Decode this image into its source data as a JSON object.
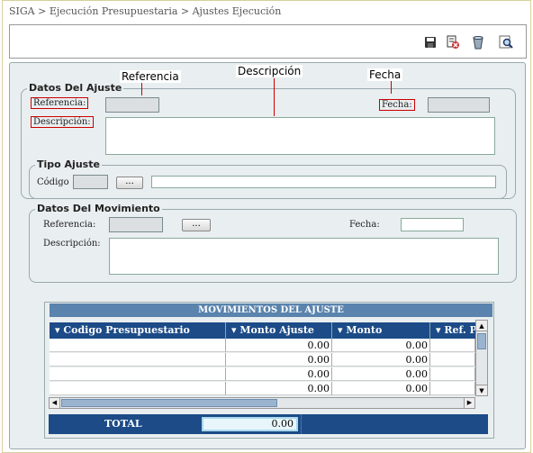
{
  "breadcrumb": "SIGA > Ejecución Presupuestaria > Ajustes Ejecución",
  "toolbar": {
    "icons": [
      "save-icon",
      "delete-icon",
      "clear-icon",
      "search-icon"
    ]
  },
  "annotations": {
    "referencia": "Referencia",
    "descripcion": "Descripción",
    "fecha": "Fecha"
  },
  "datos_ajuste": {
    "legend": "Datos Del Ajuste",
    "referencia_label": "Referencia:",
    "descripcion_label": "Descripción:",
    "fecha_label": "Fecha:",
    "referencia_value": "",
    "fecha_value": "",
    "descripcion_value": ""
  },
  "tipo_ajuste": {
    "legend": "Tipo Ajuste",
    "codigo_label": "Código",
    "button_label": "...",
    "codigo_value": "",
    "descripcion_value": ""
  },
  "datos_movimiento": {
    "legend": "Datos Del Movimiento",
    "referencia_label": "Referencia:",
    "fecha_label": "Fecha:",
    "descripcion_label": "Descripción:",
    "button_label": "...",
    "referencia_value": "",
    "fecha_value": "",
    "descripcion_value": ""
  },
  "grid": {
    "title": "MOVIMIENTOS DEL AJUSTE",
    "columns": [
      "Codigo Presupuestario",
      "Monto Ajuste",
      "Monto",
      "Ref. P"
    ],
    "rows": [
      [
        "",
        "0.00",
        "0.00",
        ""
      ],
      [
        "",
        "0.00",
        "0.00",
        ""
      ],
      [
        "",
        "0.00",
        "0.00",
        ""
      ],
      [
        "",
        "0.00",
        "0.00",
        ""
      ]
    ],
    "total_label": "TOTAL",
    "total_value": "0.00"
  }
}
